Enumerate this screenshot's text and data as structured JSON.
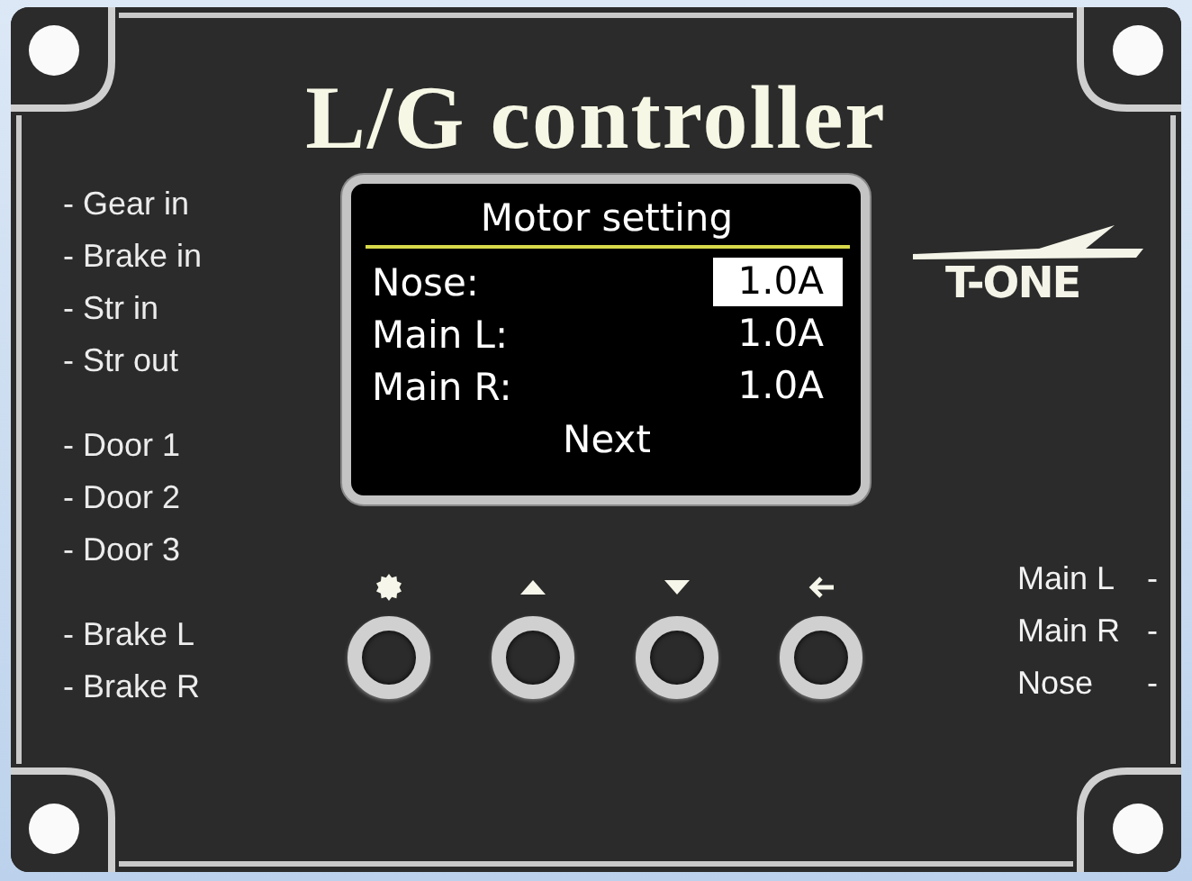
{
  "title": "L/G controller",
  "input_labels": [
    [
      "- Gear in",
      "- Brake in",
      "- Str in",
      "- Str out"
    ],
    [
      "- Door 1",
      "- Door 2",
      "- Door 3"
    ],
    [
      "- Brake L",
      "- Brake R"
    ]
  ],
  "display": {
    "title": "Motor setting",
    "rows": [
      {
        "label": "Nose:",
        "value": "1.0A",
        "selected": true
      },
      {
        "label": "Main L:",
        "value": "1.0A",
        "selected": false
      },
      {
        "label": "Main R:",
        "value": "1.0A",
        "selected": false
      }
    ],
    "action": "Next"
  },
  "buttons": [
    {
      "kind": "gear"
    },
    {
      "kind": "up"
    },
    {
      "kind": "down"
    },
    {
      "kind": "back"
    }
  ],
  "logo": "T-ONE",
  "output_labels": [
    {
      "label": "Main L",
      "dash": "-"
    },
    {
      "label": "Main R",
      "dash": "-"
    },
    {
      "label": "Nose",
      "dash": "-"
    }
  ]
}
